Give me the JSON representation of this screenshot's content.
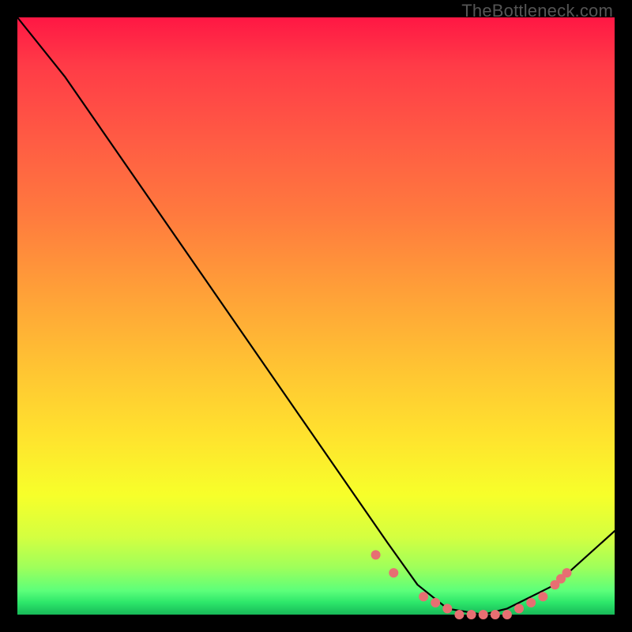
{
  "attribution": "TheBottleneck.com",
  "chart_data": {
    "type": "line",
    "title": "",
    "xlabel": "",
    "ylabel": "",
    "xlim": [
      0,
      100
    ],
    "ylim": [
      0,
      100
    ],
    "series": [
      {
        "name": "bottleneck-curve",
        "x": [
          0,
          8,
          62,
          67,
          72,
          78,
          82,
          90,
          100
        ],
        "values": [
          100,
          90,
          12,
          5,
          1,
          0,
          1,
          5,
          14
        ]
      }
    ],
    "markers": {
      "name": "highlighted-points",
      "color": "#e76f72",
      "points_x": [
        60,
        63,
        68,
        70,
        72,
        74,
        76,
        78,
        80,
        82,
        84,
        86,
        88,
        90,
        91,
        92
      ],
      "points_y": [
        10,
        7,
        3,
        2,
        1,
        0,
        0,
        0,
        0,
        0,
        1,
        2,
        3,
        5,
        6,
        7
      ]
    }
  }
}
